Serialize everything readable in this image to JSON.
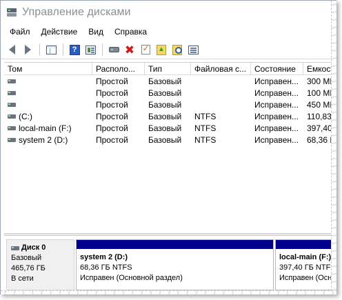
{
  "window": {
    "title": "Управление дисками",
    "icon": "disk-management-icon"
  },
  "menu": [
    "Файл",
    "Действие",
    "Вид",
    "Справка"
  ],
  "toolbar": [
    {
      "name": "back-icon"
    },
    {
      "name": "forward-icon"
    },
    {
      "name": "show-hide-console-tree-icon"
    },
    {
      "name": "help-icon"
    },
    {
      "name": "show-hide-action-pane-icon"
    },
    {
      "name": "connect-disk-icon"
    },
    {
      "name": "delete-icon"
    },
    {
      "name": "properties-icon"
    },
    {
      "name": "open-icon"
    },
    {
      "name": "explore-icon"
    },
    {
      "name": "list-view-icon"
    }
  ],
  "table": {
    "columns": [
      "Том",
      "Располо...",
      "Тип",
      "Файловая с...",
      "Состояние",
      "Емкост"
    ],
    "rows": [
      {
        "volume": "",
        "layout": "Простой",
        "type": "Базовый",
        "fs": "",
        "status": "Исправен...",
        "capacity": "300 МБ"
      },
      {
        "volume": "",
        "layout": "Простой",
        "type": "Базовый",
        "fs": "",
        "status": "Исправен...",
        "capacity": "100 МБ"
      },
      {
        "volume": "",
        "layout": "Простой",
        "type": "Базовый",
        "fs": "",
        "status": "Исправен...",
        "capacity": "450 МБ"
      },
      {
        "volume": "(C:)",
        "layout": "Простой",
        "type": "Базовый",
        "fs": "NTFS",
        "status": "Исправен...",
        "capacity": "110,83"
      },
      {
        "volume": "local-main (F:)",
        "layout": "Простой",
        "type": "Базовый",
        "fs": "NTFS",
        "status": "Исправен...",
        "capacity": "397,40"
      },
      {
        "volume": "system 2 (D:)",
        "layout": "Простой",
        "type": "Базовый",
        "fs": "NTFS",
        "status": "Исправен...",
        "capacity": "68,36 Г"
      }
    ]
  },
  "disk": {
    "name": "Диск 0",
    "type": "Базовый",
    "size": "465,76 ГБ",
    "state": "В сети",
    "partitions": [
      {
        "name": "system 2  (D:)",
        "size_fs": "68,36 ГБ NTFS",
        "status": "Исправен (Основной раздел)"
      },
      {
        "name": "local-main (F:)",
        "size_fs": "397,40 ГБ NTFS",
        "status": "Исправен (Осн"
      }
    ]
  },
  "colors": {
    "partition_bar": "#00008b",
    "title_text": "#8b8f95"
  }
}
